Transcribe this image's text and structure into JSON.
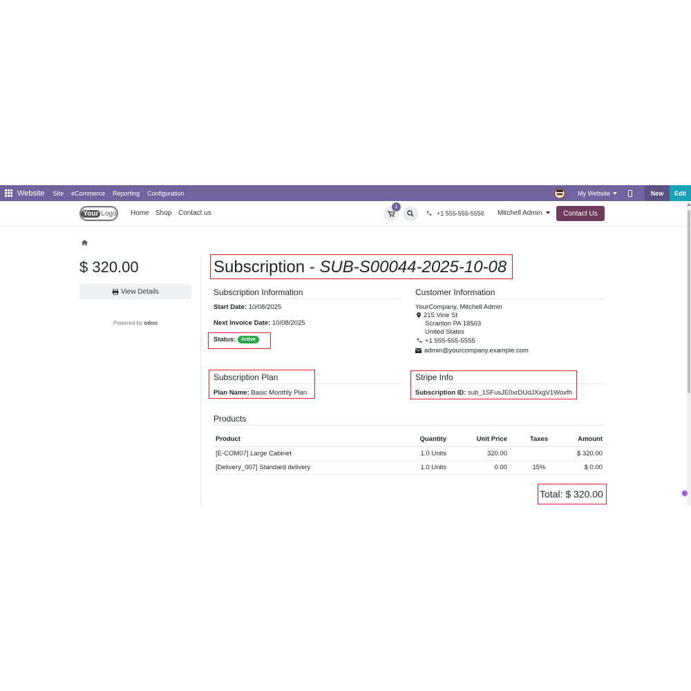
{
  "adminbar": {
    "brand": "Website",
    "menus": [
      "Site",
      "eCommerce",
      "Reporting",
      "Configuration"
    ],
    "website_selector": "My Website",
    "new_label": "New",
    "edit_label": "Edit",
    "colors": {
      "bar": "#71639e",
      "edit": "#17a2b8"
    }
  },
  "header": {
    "logo_text_a": "Your",
    "logo_text_b": "Logo",
    "nav": [
      "Home",
      "Shop",
      "Contact us"
    ],
    "cart_count": "1",
    "phone": "+1 555-555-5556",
    "user": "Mitchell Admin",
    "contact_button": "Contact Us",
    "colors": {
      "contact_button": "#6e3d5d"
    }
  },
  "sidebar": {
    "price": "$ 320.00",
    "view_details": "View Details",
    "powered_by": "Powered by",
    "powered_brand": "odoo"
  },
  "subscription": {
    "title_prefix": "Subscription - ",
    "title_ref": "SUB-S00044-2025-10-08",
    "info": {
      "heading": "Subscription Information",
      "start_label": "Start Date:",
      "start_value": "10/08/2025",
      "next_invoice_label": "Next Invoice Date:",
      "next_invoice_value": "10/08/2025",
      "status_label": "Status:",
      "status_value": "Active"
    },
    "customer": {
      "heading": "Customer Information",
      "name": "YourCompany, Mitchell Admin",
      "street": "215 Vine St",
      "city": "Scranton PA 18503",
      "country": "United States",
      "phone": "+1 555-555-5555",
      "email": "admin@yourcompany.example.com"
    },
    "plan": {
      "heading": "Subscription Plan",
      "label": "Plan Name:",
      "value": "Basic Monthly Plan"
    },
    "stripe": {
      "heading": "Stripe Info",
      "label": "Subscription ID:",
      "value": "sub_1SFusJE0xrDUdJXxgV1Woxfh"
    },
    "products": {
      "heading": "Products",
      "columns": [
        "Product",
        "Quantity",
        "Unit Price",
        "Taxes",
        "Amount"
      ],
      "rows": [
        [
          "[E-COM07] Large Cabinet",
          "1.0 Units",
          "320.00",
          "",
          "$ 320.00"
        ],
        [
          "[Delivery_007] Standard delivery",
          "1.0 Units",
          "0.00",
          "15%",
          "$ 0.00"
        ]
      ]
    },
    "total": "Total: $ 320.00"
  }
}
